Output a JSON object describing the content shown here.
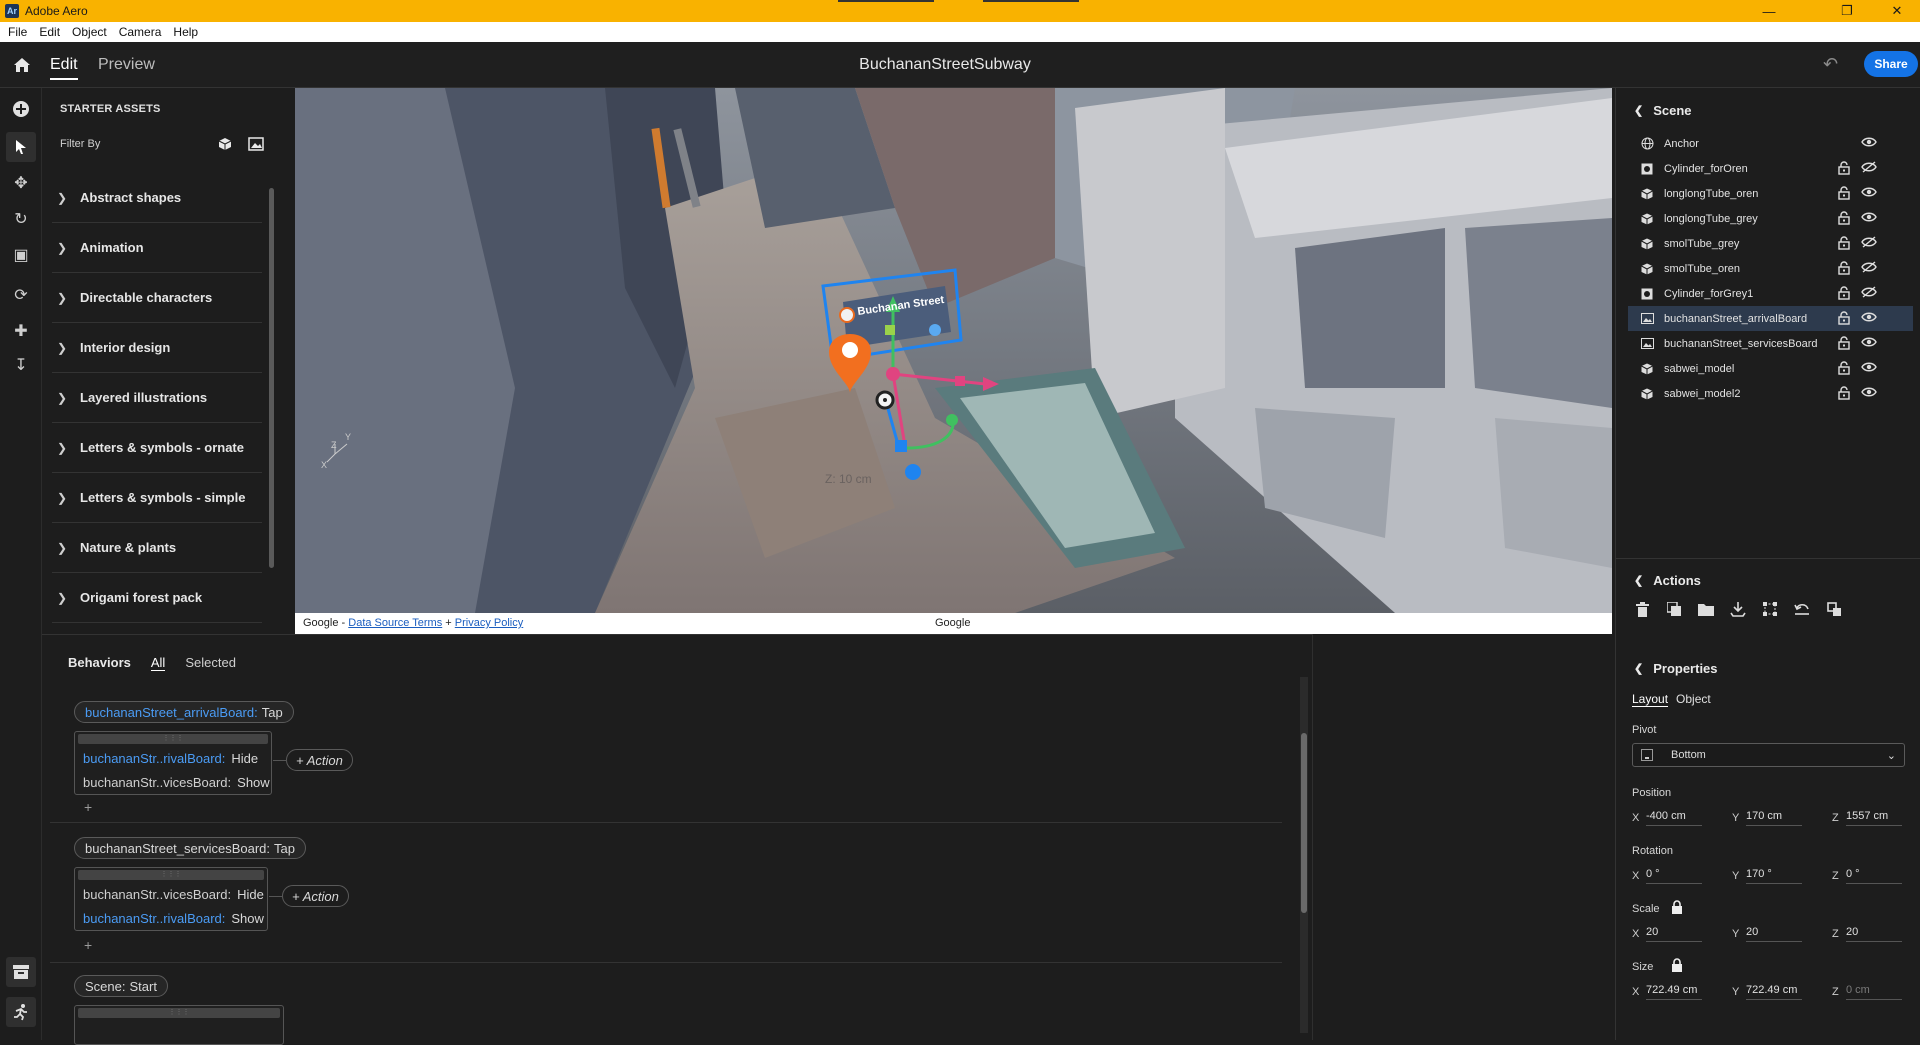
{
  "window": {
    "app_title": "Adobe Aero",
    "app_icon": "Ar"
  },
  "menu": [
    "File",
    "Edit",
    "Object",
    "Camera",
    "Help"
  ],
  "topbar": {
    "edit": "Edit",
    "preview": "Preview",
    "document_title": "BuchananStreetSubway",
    "share": "Share"
  },
  "assets": {
    "header": "STARTER ASSETS",
    "filter_label": "Filter By",
    "categories": [
      "Abstract shapes",
      "Animation",
      "Directable characters",
      "Interior design",
      "Layered illustrations",
      "Letters & symbols - ornate",
      "Letters & symbols - simple",
      "Nature & plants",
      "Origami forest pack"
    ]
  },
  "viewport": {
    "board_label": "Buchanan Street",
    "measure": "Z: 10 cm",
    "axis_y": "Y",
    "axis_x": "X",
    "axis_z": "Z",
    "footer": {
      "google_prefix": "Google -",
      "data_source": "Data Source Terms",
      "plus": "+",
      "privacy": "Privacy Policy",
      "google_center": "Google"
    }
  },
  "behaviors": {
    "title": "Behaviors",
    "tab_all": "All",
    "tab_selected": "Selected",
    "add_action": "+ Action",
    "add": "+",
    "groups": [
      {
        "object": "buchananStreet_arrivalBoard:",
        "event": "Tap",
        "actions": [
          {
            "object": "buchananStr..rivalBoard:",
            "verb": "Hide"
          },
          {
            "object": "buchananStr..vicesBoard:",
            "verb": "Show"
          }
        ]
      },
      {
        "object": "buchananStreet_servicesBoard:",
        "event": "Tap",
        "actions": [
          {
            "object": "buchananStr..vicesBoard:",
            "verb": "Hide"
          },
          {
            "object": "buchananStr..rivalBoard:",
            "verb": "Show"
          }
        ]
      },
      {
        "object": "Scene:",
        "event": "Start"
      }
    ]
  },
  "scene": {
    "title": "Scene",
    "items": [
      {
        "name": "Anchor",
        "icon": "globe-icon"
      },
      {
        "name": "Cylinder_forOren",
        "icon": "image-object-icon"
      },
      {
        "name": "longlongTube_oren",
        "icon": "cube-icon"
      },
      {
        "name": "longlongTube_grey",
        "icon": "cube-icon"
      },
      {
        "name": "smolTube_grey",
        "icon": "cube-icon"
      },
      {
        "name": "smolTube_oren",
        "icon": "cube-icon"
      },
      {
        "name": "Cylinder_forGrey1",
        "icon": "image-object-icon"
      },
      {
        "name": "buchananStreet_arrivalBoard",
        "icon": "image-icon"
      },
      {
        "name": "buchananStreet_servicesBoard",
        "icon": "image-icon"
      },
      {
        "name": "sabwei_model",
        "icon": "cube-icon"
      },
      {
        "name": "sabwei_model2",
        "icon": "cube-icon"
      }
    ]
  },
  "actions": {
    "title": "Actions"
  },
  "properties": {
    "title": "Properties",
    "tab_layout": "Layout",
    "tab_object": "Object",
    "pivot_label": "Pivot",
    "pivot_value": "Bottom",
    "position_label": "Position",
    "position": {
      "x": "-400 cm",
      "y": "170 cm",
      "z": "1557 cm"
    },
    "rotation_label": "Rotation",
    "rotation": {
      "x": "0 °",
      "y": "170 °",
      "z": "0 °"
    },
    "scale_label": "Scale",
    "scale": {
      "x": "20",
      "y": "20",
      "z": "20"
    },
    "size_label": "Size",
    "size": {
      "x": "722.49 cm",
      "y": "722.49 cm",
      "z": "0 cm"
    },
    "axis_x": "X",
    "axis_y": "Y",
    "axis_z": "Z"
  },
  "colors": {
    "titlebar": "#f9b200",
    "accent": "#1473e6",
    "link_blue": "#4b9cf5",
    "selection": "#2d3a4d"
  }
}
